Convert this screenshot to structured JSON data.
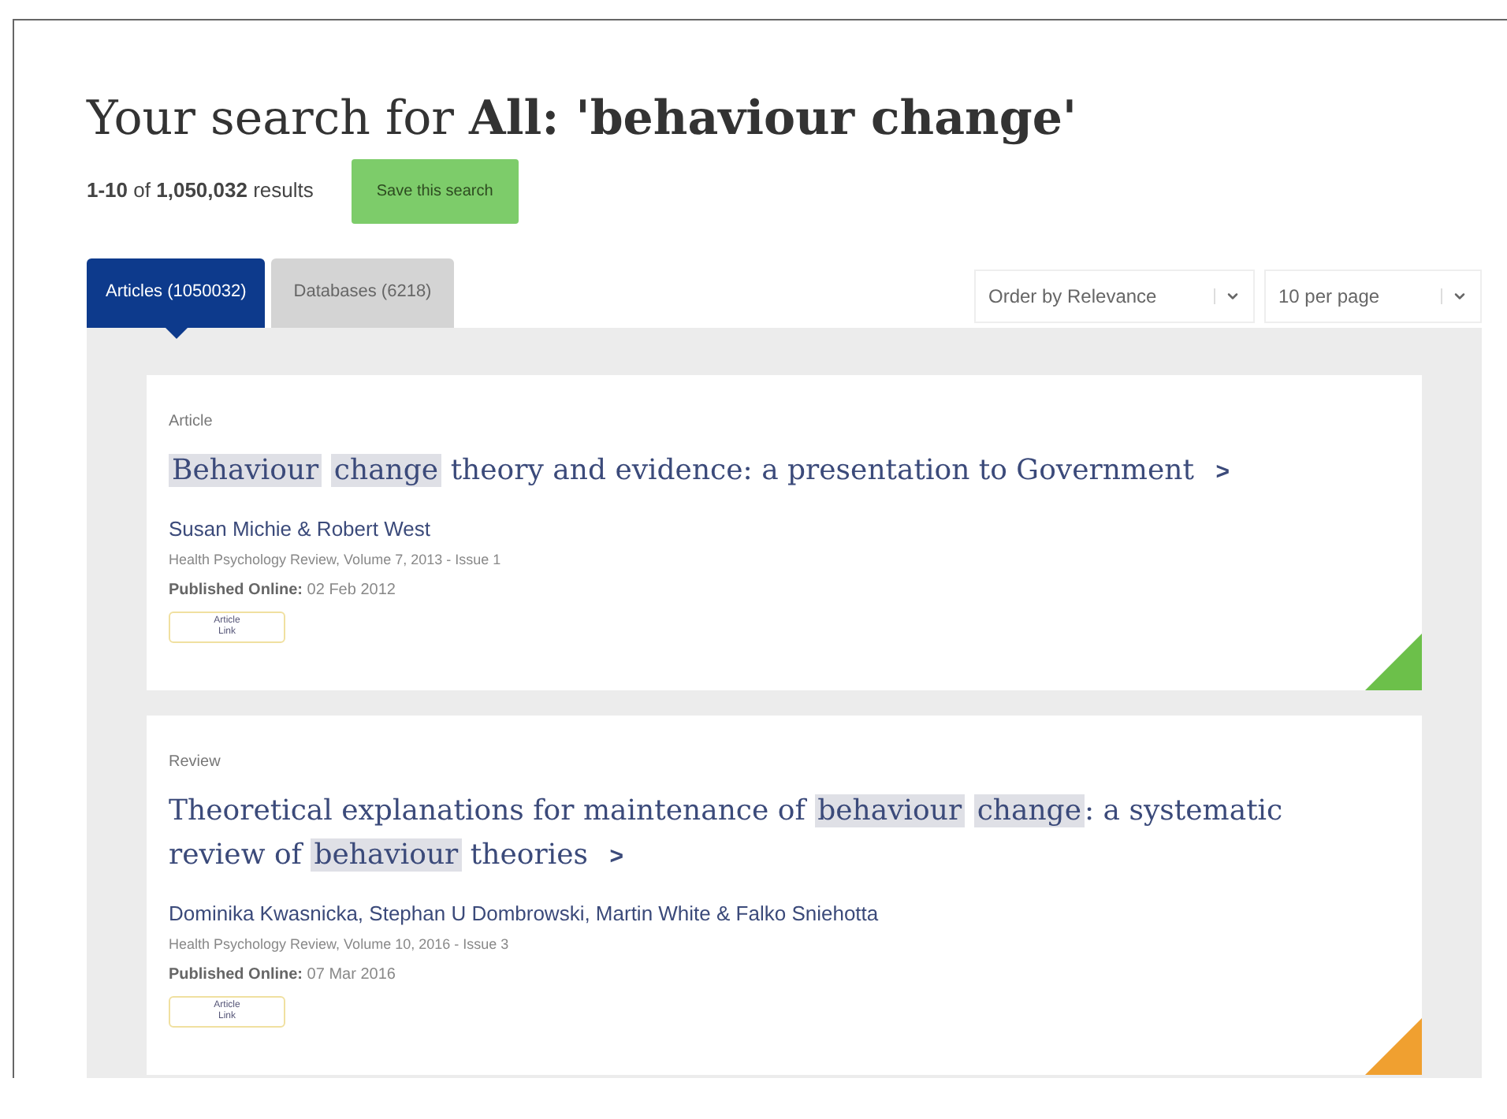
{
  "heading": {
    "prefix": "Your search for",
    "query": "All: 'behaviour change'"
  },
  "summary": {
    "range": "1-10",
    "of": "of",
    "total": "1,050,032",
    "suffix": "results"
  },
  "save_button": "Save this search",
  "tabs": [
    {
      "label": "Articles (1050032)",
      "selected": true
    },
    {
      "label": "Databases (6218)",
      "selected": false
    }
  ],
  "sort": {
    "value": "Order by Relevance"
  },
  "per_page": {
    "value": "10 per page"
  },
  "results": [
    {
      "type": "Article",
      "title": [
        {
          "text": "Behaviour",
          "highlight": true
        },
        {
          "text": "change",
          "highlight": true
        },
        {
          "text": "theory and evidence: a presentation to Government",
          "highlight": false
        }
      ],
      "chevron": ">",
      "authors": "Susan Michie & Robert West",
      "source": "Health Psychology Review, Volume 7, 2013 - Issue 1",
      "published_label": "Published Online:",
      "published": "02 Feb 2012",
      "link_badge": [
        "Article",
        "Link"
      ],
      "color": "#6cc04a"
    },
    {
      "type": "Review",
      "title": [
        {
          "text": "Theoretical explanations for maintenance of",
          "highlight": false
        },
        {
          "text": "behaviour",
          "highlight": true
        },
        {
          "text": "change",
          "highlight": true
        },
        {
          "text": ": a systematic review of",
          "highlight": false
        },
        {
          "text": "behaviour",
          "highlight": true
        },
        {
          "text": "theories",
          "highlight": false
        }
      ],
      "chevron": ">",
      "authors": "Dominika Kwasnicka, Stephan U Dombrowski, Martin White & Falko Sniehotta",
      "source": "Health Psychology Review, Volume 10, 2016 - Issue 3",
      "published_label": "Published Online:",
      "published": "07 Mar 2016",
      "link_badge": [
        "Article",
        "Link"
      ],
      "color": "#f0a030"
    }
  ]
}
